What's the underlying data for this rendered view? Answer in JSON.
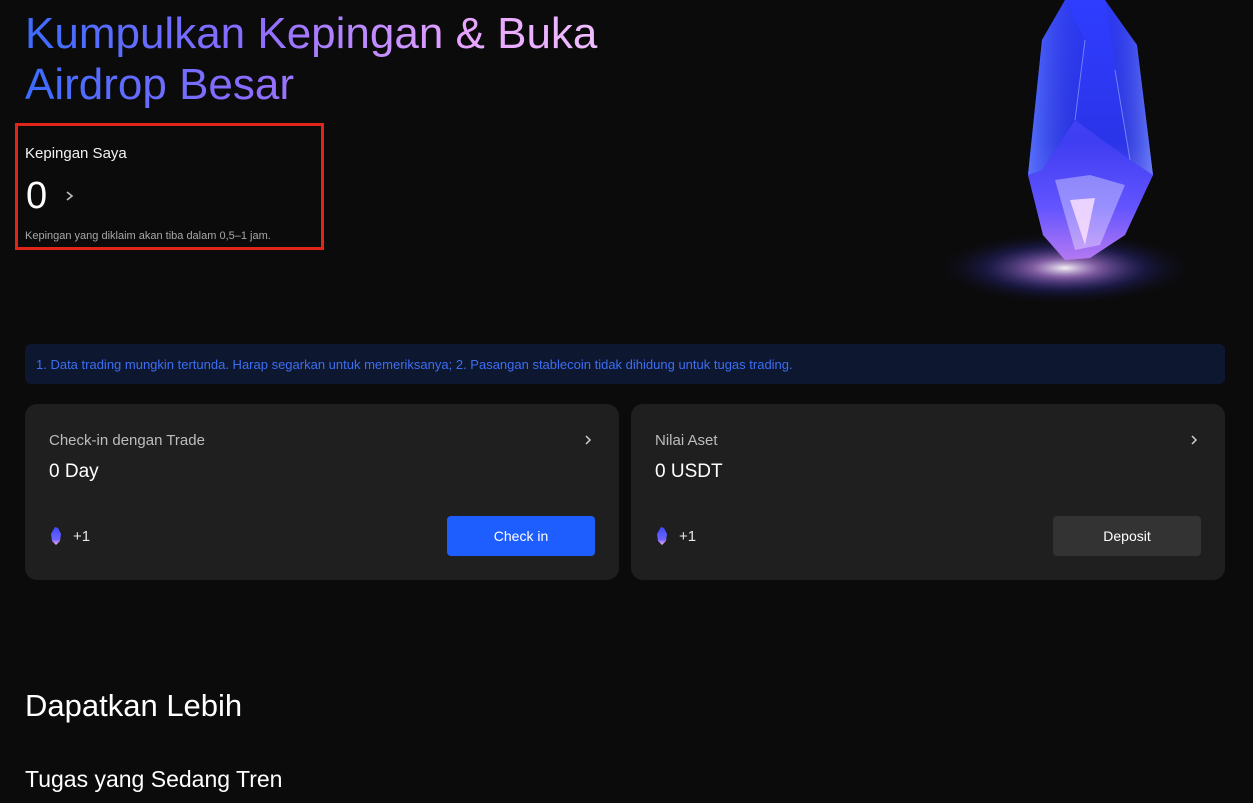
{
  "hero": {
    "title": "Kumpulkan Kepingan & Buka Airdrop Besar"
  },
  "my_shards": {
    "label": "Kepingan Saya",
    "count": "0",
    "note": "Kepingan yang diklaim akan tiba dalam 0,5–1 jam."
  },
  "notice": {
    "text": "1. Data trading mungkin tertunda. Harap segarkan untuk memeriksanya; 2. Pasangan stablecoin tidak dihidung untuk tugas trading."
  },
  "cards": [
    {
      "title": "Check-in dengan Trade",
      "value": "0 Day",
      "reward": "+1",
      "button_label": "Check in"
    },
    {
      "title": "Nilai Aset",
      "value": "0 USDT",
      "reward": "+1",
      "button_label": "Deposit"
    }
  ],
  "sections": {
    "earn_more": "Dapatkan Lebih",
    "trending_tasks": "Tugas yang Sedang Tren"
  },
  "colors": {
    "background": "#0b0b0b",
    "card": "#1f1f1f",
    "primary_button": "#1e5eff",
    "secondary_button": "#333333",
    "notice_text": "#3d6df2",
    "highlight_border": "#e0261a"
  },
  "icons": {
    "shards_chevron": "chevron-right-icon",
    "card_chevron": "chevron-right-icon",
    "reward": "crystal-shard-icon",
    "hero": "crystal-illustration"
  }
}
